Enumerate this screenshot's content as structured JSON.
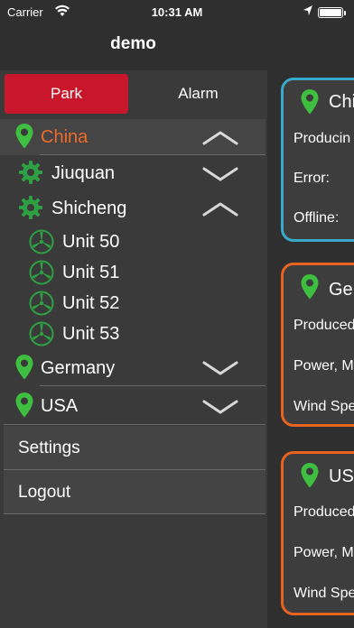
{
  "status_bar": {
    "carrier": "Carrier",
    "time": "10:31 AM"
  },
  "header": {
    "title": "demo"
  },
  "sidebar": {
    "tabs": {
      "park": "Park",
      "alarm": "Alarm"
    },
    "tree": {
      "china": "China",
      "jiuquan": "Jiuquan",
      "shicheng": "Shicheng",
      "units": [
        "Unit 50",
        "Unit 51",
        "Unit 52",
        "Unit 53"
      ],
      "germany": "Germany",
      "usa": "USA"
    },
    "menu": {
      "settings": "Settings",
      "logout": "Logout"
    }
  },
  "cards": [
    {
      "title": "Chi",
      "lines": [
        "Producin",
        "Error:",
        "Offline:"
      ],
      "border": "#39a9c9"
    },
    {
      "title": "Ger",
      "lines": [
        "Produced",
        "Power, M",
        "Wind Spe"
      ],
      "border": "#e8631f"
    },
    {
      "title": "USA",
      "lines": [
        "Produced",
        "Power, M",
        "Wind Spe"
      ],
      "border": "#e8631f"
    }
  ],
  "colors": {
    "accent": "#c8172b",
    "active_label": "#ef6a2a",
    "pin_green": "#3fbf3f",
    "icon_green": "#2ea043"
  }
}
